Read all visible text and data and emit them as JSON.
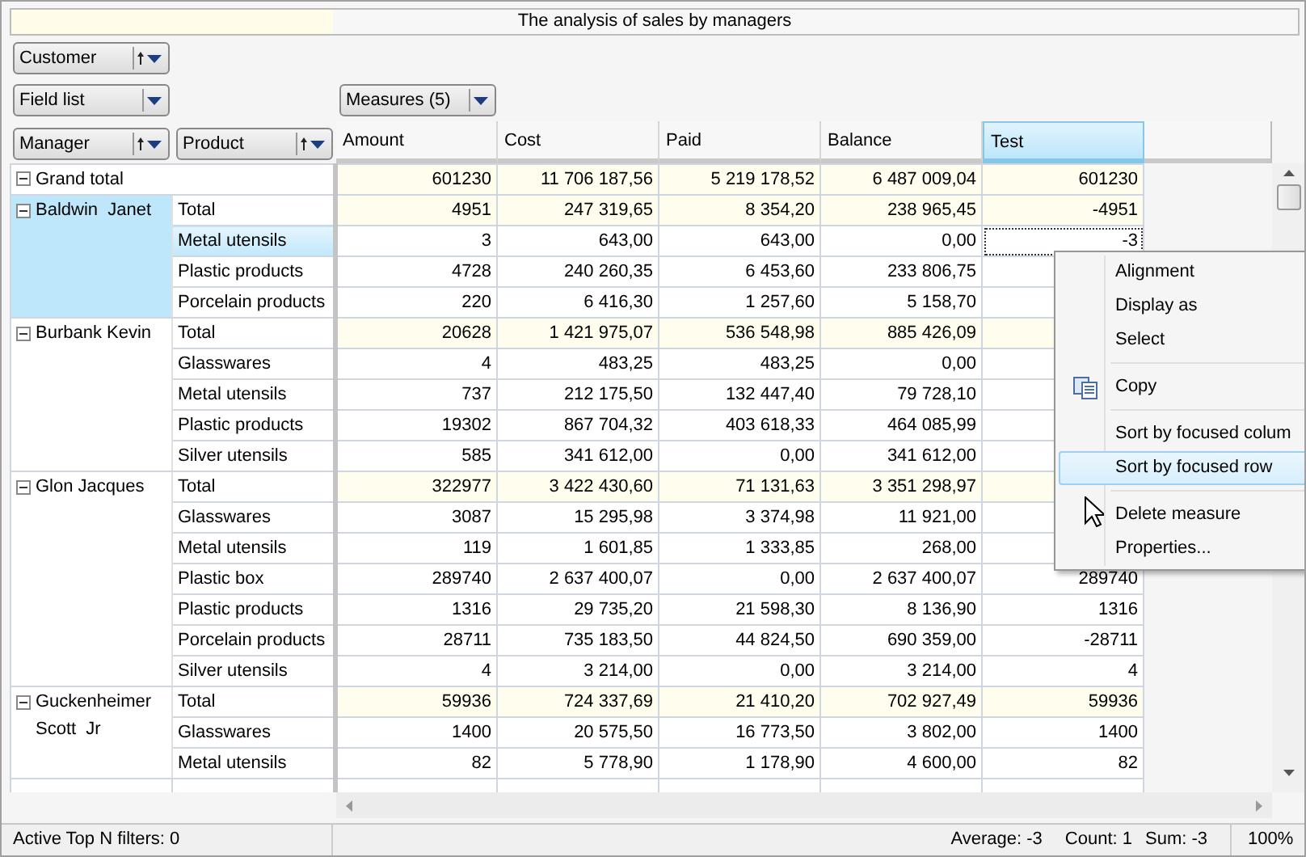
{
  "title": "The analysis of sales by managers",
  "filter_fields": [
    {
      "label": "Customer",
      "sortable": true
    }
  ],
  "field_list": {
    "label": "Field list"
  },
  "measures_button": {
    "label": "Measures (5)"
  },
  "row_fields": [
    {
      "label": "Manager",
      "sortable": true
    },
    {
      "label": "Product",
      "sortable": true
    }
  ],
  "columns": [
    {
      "label": "Amount",
      "selected": false
    },
    {
      "label": "Cost",
      "selected": false
    },
    {
      "label": "Paid",
      "selected": false
    },
    {
      "label": "Balance",
      "selected": false
    },
    {
      "label": "Test",
      "selected": true
    }
  ],
  "grand_total": {
    "label": "Grand total",
    "expanded": true,
    "values": [
      "601230",
      "11 706 187,56",
      "5 219 178,52",
      "6 487 009,04",
      "601230"
    ]
  },
  "managers": [
    {
      "name": "Baldwin  Janet",
      "expanded": true,
      "selected": true,
      "rows": [
        {
          "kind": "total",
          "label": "Total",
          "selected": false,
          "values": [
            "4951",
            "247 319,65",
            "8 354,20",
            "238 965,45",
            "-4951"
          ]
        },
        {
          "kind": "item",
          "label": "Metal utensils",
          "selected": true,
          "values": [
            "3",
            "643,00",
            "643,00",
            "0,00",
            "-3"
          ]
        },
        {
          "kind": "item",
          "label": "Plastic products",
          "selected": false,
          "values": [
            "4728",
            "240 260,35",
            "6 453,60",
            "233 806,75"
          ]
        },
        {
          "kind": "item",
          "label": "Porcelain products",
          "selected": false,
          "values": [
            "220",
            "6 416,30",
            "1 257,60",
            "5 158,70"
          ]
        }
      ]
    },
    {
      "name": "Burbank Kevin",
      "expanded": true,
      "selected": false,
      "rows": [
        {
          "kind": "total",
          "label": "Total",
          "selected": false,
          "values": [
            "20628",
            "1 421 975,07",
            "536 548,98",
            "885 426,09"
          ]
        },
        {
          "kind": "item",
          "label": "Glasswares",
          "selected": false,
          "values": [
            "4",
            "483,25",
            "483,25",
            "0,00"
          ]
        },
        {
          "kind": "item",
          "label": "Metal utensils",
          "selected": false,
          "values": [
            "737",
            "212 175,50",
            "132 447,40",
            "79 728,10"
          ]
        },
        {
          "kind": "item",
          "label": "Plastic products",
          "selected": false,
          "values": [
            "19302",
            "867 704,32",
            "403 618,33",
            "464 085,99"
          ]
        },
        {
          "kind": "item",
          "label": "Silver utensils",
          "selected": false,
          "values": [
            "585",
            "341 612,00",
            "0,00",
            "341 612,00"
          ]
        }
      ]
    },
    {
      "name": "Glon Jacques",
      "expanded": true,
      "selected": false,
      "rows": [
        {
          "kind": "total",
          "label": "Total",
          "selected": false,
          "values": [
            "322977",
            "3 422 430,60",
            "71 131,63",
            "3 351 298,97"
          ]
        },
        {
          "kind": "item",
          "label": "Glasswares",
          "selected": false,
          "values": [
            "3087",
            "15 295,98",
            "3 374,98",
            "11 921,00"
          ]
        },
        {
          "kind": "item",
          "label": "Metal utensils",
          "selected": false,
          "values": [
            "119",
            "1 601,85",
            "1 333,85",
            "268,00"
          ]
        },
        {
          "kind": "item",
          "label": "Plastic box",
          "selected": false,
          "values": [
            "289740",
            "2 637 400,07",
            "0,00",
            "2 637 400,07",
            "289740"
          ]
        },
        {
          "kind": "item",
          "label": "Plastic products",
          "selected": false,
          "values": [
            "1316",
            "29 735,20",
            "21 598,30",
            "8 136,90",
            "1316"
          ]
        },
        {
          "kind": "item",
          "label": "Porcelain products",
          "selected": false,
          "values": [
            "28711",
            "735 183,50",
            "44 824,50",
            "690 359,00",
            "-28711"
          ]
        },
        {
          "kind": "item",
          "label": "Silver utensils",
          "selected": false,
          "values": [
            "4",
            "3 214,00",
            "0,00",
            "3 214,00",
            "4"
          ]
        }
      ]
    },
    {
      "name": "Guckenheimer Scott  Jr",
      "expanded": true,
      "selected": false,
      "rows": [
        {
          "kind": "total",
          "label": "Total",
          "selected": false,
          "values": [
            "59936",
            "724 337,69",
            "21 410,20",
            "702 927,49",
            "59936"
          ]
        },
        {
          "kind": "item",
          "label": "Glasswares",
          "selected": false,
          "values": [
            "1400",
            "20 575,50",
            "16 773,50",
            "3 802,00",
            "1400"
          ]
        },
        {
          "kind": "item",
          "label": "Metal utensils",
          "selected": false,
          "values": [
            "82",
            "5 778,90",
            "1 178,90",
            "4 600,00",
            "82"
          ]
        }
      ]
    }
  ],
  "context_menu": {
    "items": [
      {
        "kind": "item",
        "label": "Alignment",
        "selected": false
      },
      {
        "kind": "item",
        "label": "Display as",
        "selected": false
      },
      {
        "kind": "item",
        "label": "Select",
        "selected": false
      },
      {
        "kind": "separator"
      },
      {
        "kind": "copy",
        "label": "Copy",
        "selected": false
      },
      {
        "kind": "separator"
      },
      {
        "kind": "item",
        "label": "Sort by focused colum",
        "selected": false
      },
      {
        "kind": "item",
        "label": "Sort by focused row",
        "selected": true
      },
      {
        "kind": "separator"
      },
      {
        "kind": "item",
        "label": "Delete measure",
        "selected": false
      },
      {
        "kind": "item",
        "label": "Properties...",
        "selected": false
      }
    ]
  },
  "status_bar": {
    "left": "Active Top N filters: 0",
    "summary": [
      "Average: -3",
      "Count: 1",
      "Sum: -3"
    ],
    "zoom": "100%"
  }
}
